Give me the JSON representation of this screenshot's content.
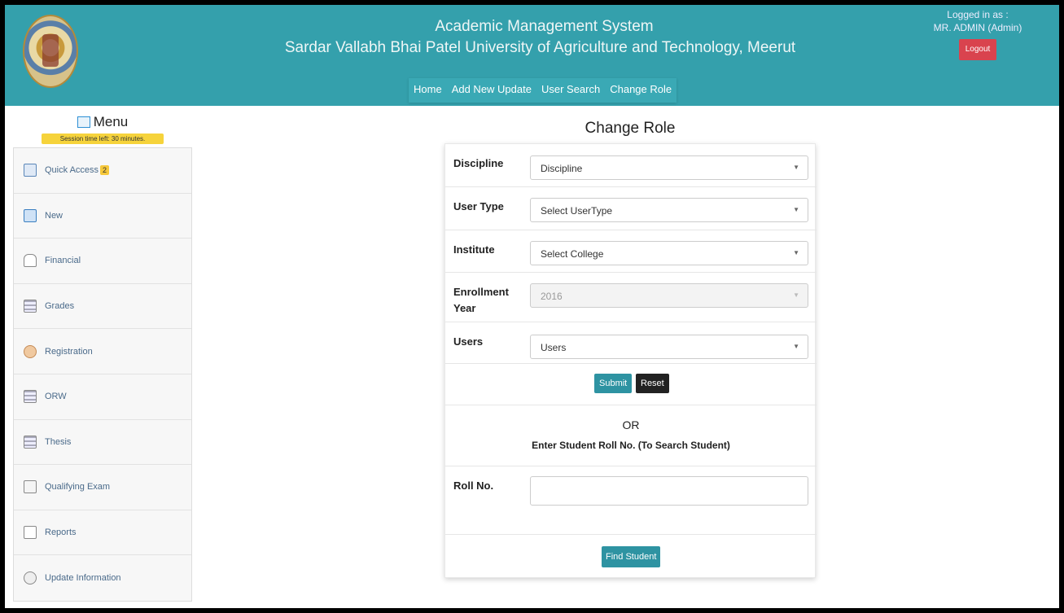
{
  "header": {
    "title_line1": "Academic Management System",
    "title_line2": "Sardar Vallabh Bhai Patel University of Agriculture and Technology, Meerut",
    "nav": [
      "Home",
      "Add New Update",
      "User Search",
      "Change Role"
    ],
    "logged_in_label": "Logged in as :",
    "logged_in_user": "MR. ADMIN (Admin)",
    "logout_label": "Logout",
    "logo_icon": "university-seal-icon"
  },
  "sidebar": {
    "title": "Menu",
    "session_text": "Session time left: 30 minutes.",
    "items": [
      {
        "label": "Quick Access",
        "badge": "2",
        "icon": "quick-access-icon"
      },
      {
        "label": "New",
        "icon": "new-document-icon"
      },
      {
        "label": "Financial",
        "icon": "bag-icon"
      },
      {
        "label": "Grades",
        "icon": "grid-icon"
      },
      {
        "label": "Registration",
        "icon": "user-icon"
      },
      {
        "label": "ORW",
        "icon": "grid-icon"
      },
      {
        "label": "Thesis",
        "icon": "grid-icon"
      },
      {
        "label": "Qualifying Exam",
        "icon": "exam-icon"
      },
      {
        "label": "Reports",
        "icon": "report-icon"
      },
      {
        "label": "Update Information",
        "icon": "update-icon"
      }
    ]
  },
  "form": {
    "title": "Change Role",
    "fields": {
      "discipline": {
        "label": "Discipline",
        "value": "Discipline"
      },
      "user_type": {
        "label": "User Type",
        "value": "Select UserType"
      },
      "institute": {
        "label": "Institute",
        "value": "Select College"
      },
      "enrollment_year_line1": "Enrollment",
      "enrollment_year_line2": "Year",
      "enrollment_year_value": "2016",
      "users": {
        "label": "Users",
        "value": "Users"
      }
    },
    "submit_label": "Submit",
    "reset_label": "Reset",
    "or_text": "OR",
    "roll_hint": "Enter Student Roll No. (To Search Student)",
    "roll_label": "Roll No.",
    "roll_value": "",
    "find_label": "Find Student"
  },
  "colors": {
    "header": "#34a0ac",
    "logout": "#d9434e",
    "submit": "#2e93a2",
    "reset": "#222222",
    "badge": "#f6c83b"
  }
}
